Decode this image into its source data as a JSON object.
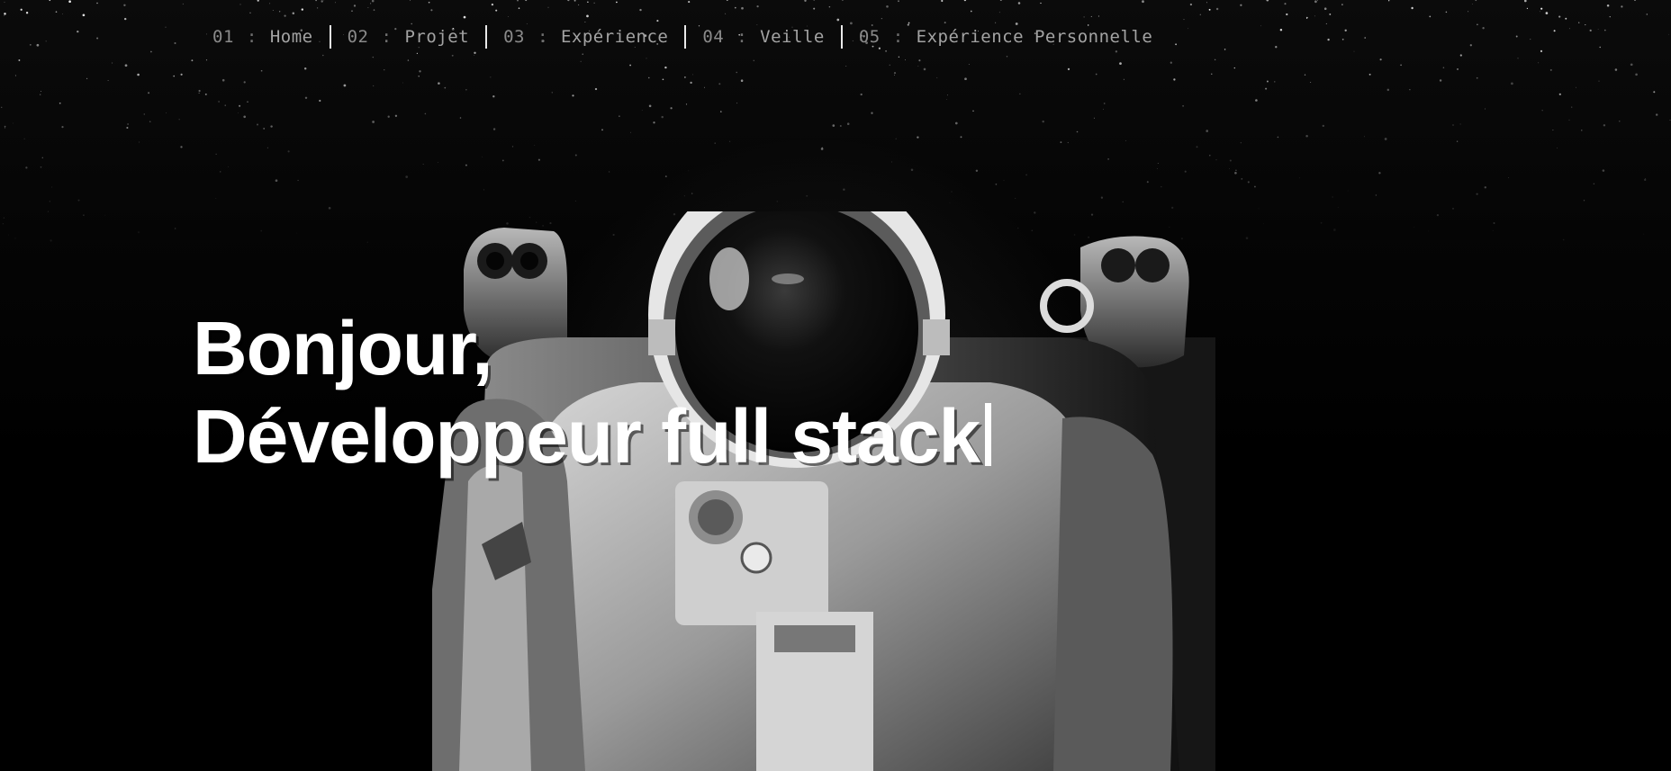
{
  "nav": {
    "items": [
      {
        "num": "01",
        "label": "Home"
      },
      {
        "num": "02",
        "label": "Projet"
      },
      {
        "num": "03",
        "label": "Expérience"
      },
      {
        "num": "04",
        "label": "Veille"
      },
      {
        "num": "05",
        "label": "Expérience Personnelle"
      }
    ],
    "separator": ":"
  },
  "hero": {
    "greeting": "Bonjour,",
    "role": "Développeur full stack"
  },
  "colors": {
    "background": "#000000",
    "nav_text": "#9a9a9a",
    "nav_divider": "#e9e9e9",
    "hero_text": "#ffffff"
  },
  "icons": {
    "background": "astronaut-image",
    "cursor": "typing-cursor-icon"
  }
}
